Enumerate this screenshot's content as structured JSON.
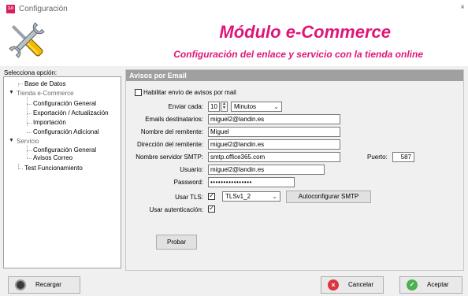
{
  "window": {
    "title": "Configuración",
    "app_icon_text": "3.0",
    "close_glyph": "×"
  },
  "banner": {
    "icon": "wrench-screwdriver-icon",
    "title": "Módulo e-Commerce",
    "subtitle": "Configuración del enlace y servicio con la tienda online",
    "accent_color": "#e0157a"
  },
  "sidebar": {
    "label": "Selecciona opción:",
    "items": [
      {
        "label": "Base de Datos"
      },
      {
        "label": "Tienda e-Commerce",
        "expanded": true
      },
      {
        "label": "Configuración General"
      },
      {
        "label": "Exportación / Actualización"
      },
      {
        "label": "Importación"
      },
      {
        "label": "Configuración Adicional"
      },
      {
        "label": "Servicio",
        "expanded": true
      },
      {
        "label": "Configuración General"
      },
      {
        "label": "Avisos Correo"
      },
      {
        "label": "Test Funcionamiento"
      }
    ]
  },
  "panel": {
    "header": "Avisos por Email",
    "enable_label": "Habilitar envío de avisos por mail",
    "enable_checked": false,
    "send_every_label": "Enviar cada:",
    "send_every_value": "10",
    "send_every_unit": "Minutos",
    "recipients_label": "Emails destinatarios:",
    "recipients_value": "miguel2@landin.es",
    "sender_name_label": "Nombre del remitente:",
    "sender_name_value": "Miguel",
    "sender_address_label": "Dirección del remitente:",
    "sender_address_value": "miguel2@landin.es",
    "smtp_server_label": "Nombre servidor SMTP:",
    "smtp_server_value": "smtp.office365.com",
    "port_label": "Puerto:",
    "port_value": "587",
    "user_label": "Usuario:",
    "user_value": "miguel2@landin.es",
    "password_label": "Password:",
    "password_value": "••••••••••••••••",
    "tls_label": "Usar TLS:",
    "tls_checked": true,
    "tls_version": "TLSv1_2",
    "autoconfig_button": "Autoconfigurar SMTP",
    "auth_label": "Usar autenticación:",
    "auth_checked": true,
    "test_button": "Probar"
  },
  "footer": {
    "reload_button": "Recargar",
    "cancel_button": "Cancelar",
    "accept_button": "Aceptar",
    "cancel_color": "#d9363e",
    "accept_color": "#4caf50"
  }
}
